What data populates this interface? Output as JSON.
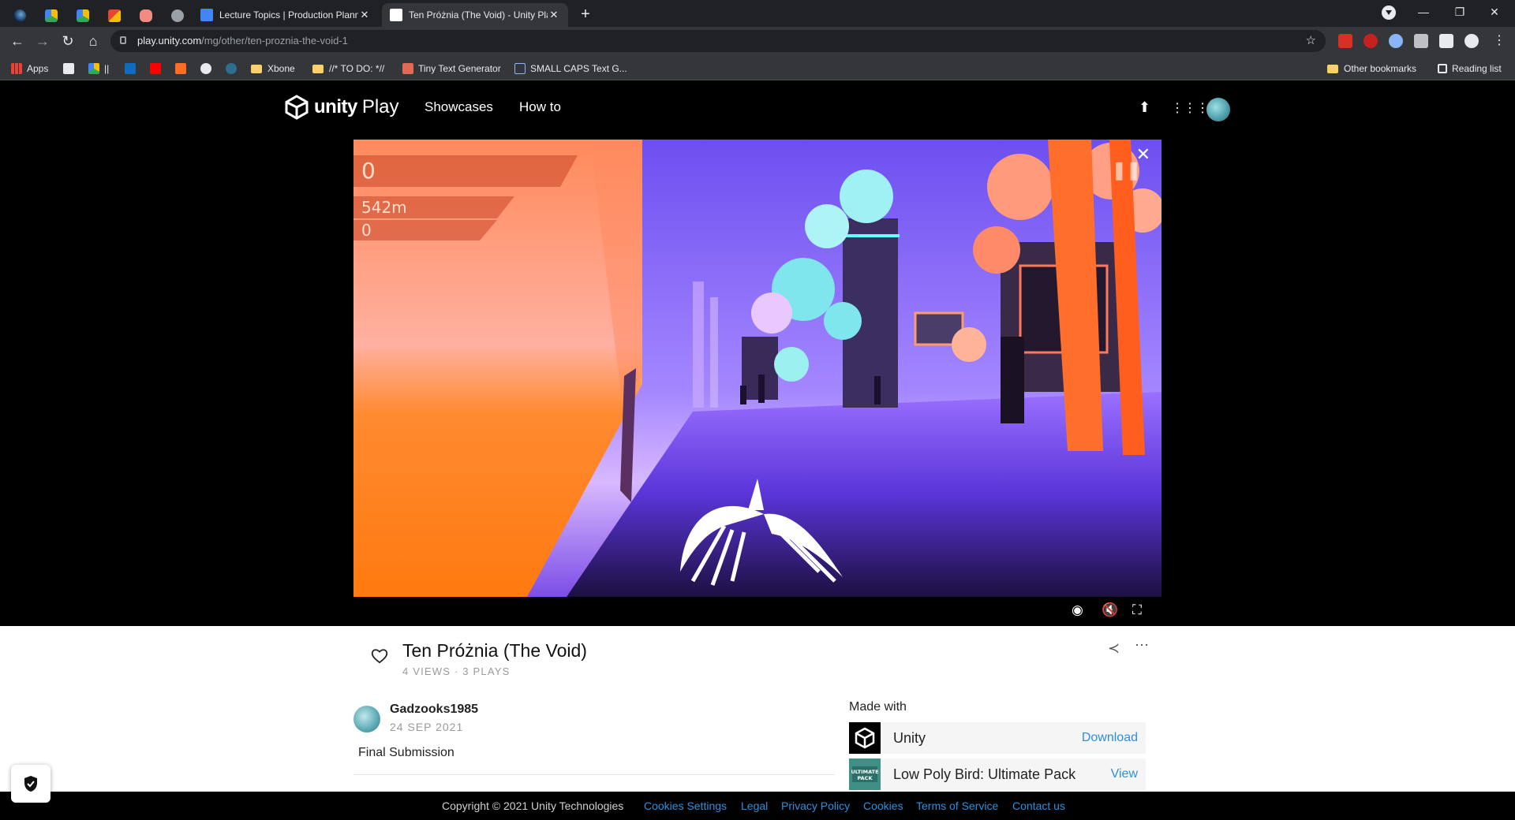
{
  "browser": {
    "tabs": [
      {
        "title": "Lecture Topics | Production Planni",
        "close": "✕"
      },
      {
        "title": "Ten Próżnia (The Void) - Unity Pla",
        "close": "✕"
      }
    ],
    "new_tab": "+",
    "window_controls": {
      "minimize": "—",
      "restore": "❐",
      "close": "✕"
    },
    "url_host": "play.unity.com",
    "url_path": "/mg/other/ten-proznia-the-void-1",
    "bookmarks": [
      {
        "label": "Apps"
      },
      {
        "label": "||"
      },
      {
        "label": "Xbone"
      },
      {
        "label": "//* TO DO: *//"
      },
      {
        "label": "Tiny Text Generator"
      },
      {
        "label": "SMALL CAPS Text G..."
      }
    ],
    "other_bookmarks": "Other bookmarks",
    "reading_list": "Reading list"
  },
  "site": {
    "brand": "unity",
    "brand_suffix": "Play",
    "nav": [
      {
        "label": "Showcases"
      },
      {
        "label": "How to"
      }
    ]
  },
  "game": {
    "hud_score": "0",
    "hud_distance": "542m",
    "hud_count": "0"
  },
  "info": {
    "title": "Ten Próżnia (The Void)",
    "stats": "4 VIEWS · 3 PLAYS",
    "author": "Gadzooks1985",
    "date": "24 SEP 2021",
    "description": "Final Submission",
    "made_with_label": "Made with",
    "tools": [
      {
        "name": "Unity",
        "link": "Download",
        "icon": "unity-icon"
      },
      {
        "name": "Low Poly Bird: Ultimate Pack",
        "link": "View",
        "icon": "ultimate-pack-icon",
        "icon_text": "ULTIMATE PACK"
      }
    ]
  },
  "footer": {
    "copyright": "Copyright © 2021 Unity Technologies",
    "links": [
      "Cookies Settings",
      "Legal",
      "Privacy Policy",
      "Cookies",
      "Terms of Service",
      "Contact us"
    ]
  },
  "colors": {
    "accent_link": "#2b8fe0",
    "chrome_dark": "#202124",
    "chrome_mid": "#35363a"
  }
}
